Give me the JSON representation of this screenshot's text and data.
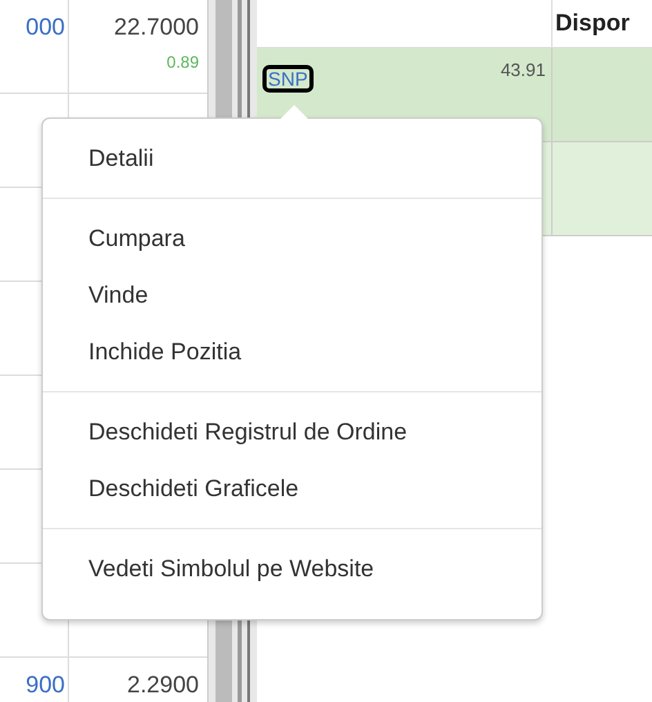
{
  "left_table": {
    "rows": [
      {
        "column_1": "000",
        "column_2": "22.7000",
        "change": "0.89"
      },
      {
        "column_1": "",
        "column_2": "",
        "change": ""
      },
      {
        "column_1": "",
        "column_2": "",
        "change": ""
      },
      {
        "column_1": "",
        "column_2": "",
        "change": ""
      },
      {
        "column_1": "",
        "column_2": "",
        "change": ""
      },
      {
        "column_1": "",
        "column_2": "",
        "change": ""
      },
      {
        "column_1": "",
        "column_2": "",
        "change": ""
      },
      {
        "column_1": "900",
        "column_2": "2.2900",
        "change": ""
      }
    ]
  },
  "right_table": {
    "header": "Dispor",
    "rows": [
      {
        "symbol": "SNP",
        "value": "43.91",
        "selected": true
      },
      {
        "symbol": "",
        "value": "",
        "selected": false
      }
    ]
  },
  "context_menu": {
    "groups": [
      [
        "Detalii"
      ],
      [
        "Cumpara",
        "Vinde",
        "Inchide Pozitia"
      ],
      [
        "Deschideti Registrul de Ordine",
        "Deschideti Graficele"
      ],
      [
        "Vedeti Simbolul pe Website"
      ]
    ]
  }
}
